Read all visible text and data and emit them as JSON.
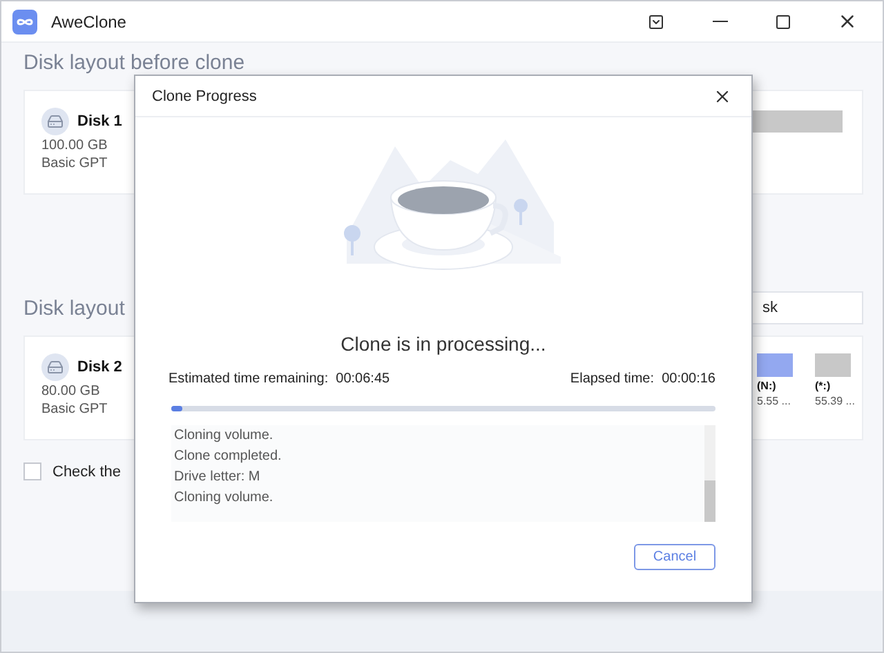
{
  "window": {
    "title": "AweClone"
  },
  "before": {
    "title": "Disk layout before clone",
    "disk": {
      "name": "Disk 1",
      "size": "100.00 GB",
      "type": "Basic GPT"
    }
  },
  "after": {
    "title": "Disk layout",
    "field_value": "sk",
    "disk": {
      "name": "Disk 2",
      "size": "80.00 GB",
      "type": "Basic GPT"
    },
    "partitions": [
      {
        "label": "(N:)",
        "size": "5.55 ...",
        "color": "#93a8f0"
      },
      {
        "label": "(*:)",
        "size": "55.39 ...",
        "color": "#c8c8c8"
      }
    ]
  },
  "option": {
    "label": "Check the",
    "checked": false
  },
  "dialog": {
    "title": "Clone Progress",
    "status": "Clone is in processing...",
    "remaining_label": "Estimated time remaining:",
    "remaining": "00:06:45",
    "elapsed_label": "Elapsed time:",
    "elapsed": "00:00:16",
    "level": 0.02,
    "log": [
      "Cloning volume.",
      "Clone completed.",
      "Drive letter: M",
      "Cloning volume."
    ],
    "cancel": "Cancel"
  }
}
